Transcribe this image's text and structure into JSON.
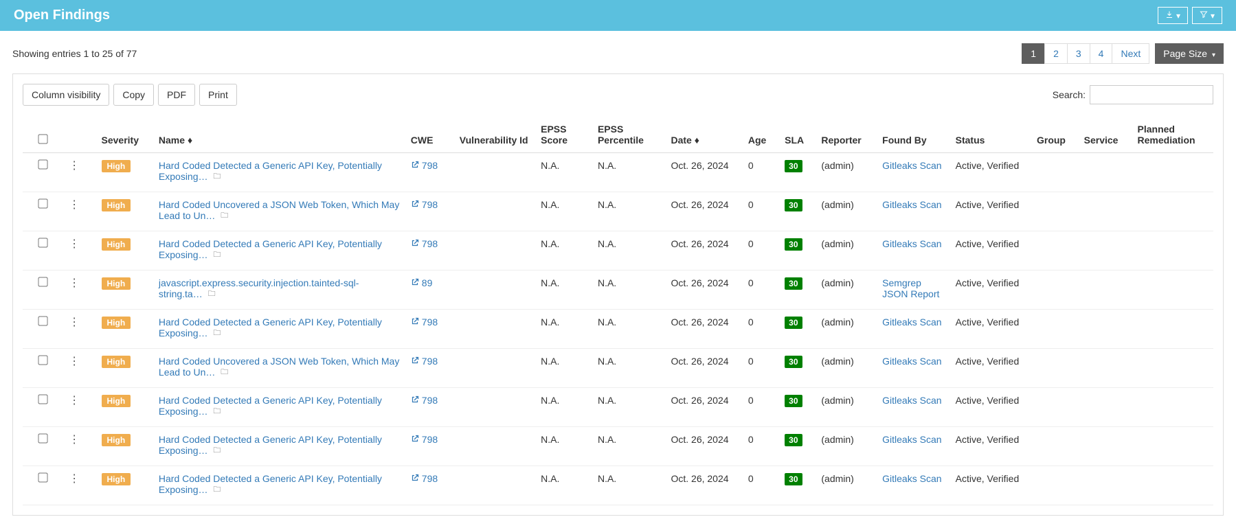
{
  "header": {
    "title": "Open Findings"
  },
  "showing": "Showing entries 1 to 25 of 77",
  "pagination": {
    "pages": [
      "1",
      "2",
      "3",
      "4"
    ],
    "active": 0,
    "next": "Next",
    "page_size": "Page Size "
  },
  "toolbar": {
    "column_visibility": "Column visibility",
    "copy": "Copy",
    "pdf": "PDF",
    "print": "Print"
  },
  "search": {
    "label": "Search:",
    "value": ""
  },
  "columns": [
    "",
    "",
    "Severity",
    "Name",
    "CWE",
    "Vulnerability Id",
    "EPSS Score",
    "EPSS Percentile",
    "Date",
    "Age",
    "SLA",
    "Reporter",
    "Found By",
    "Status",
    "Group",
    "Service",
    "Planned Remediation"
  ],
  "rows": [
    {
      "severity": "High",
      "name": "Hard Coded Detected a Generic API Key, Potentially Exposing…",
      "cwe": "798",
      "epss_score": "N.A.",
      "epss_pct": "N.A.",
      "date": "Oct. 26, 2024",
      "age": "0",
      "sla": "30",
      "reporter": "(admin)",
      "found_by": "Gitleaks Scan",
      "status": "Active, Verified"
    },
    {
      "severity": "High",
      "name": "Hard Coded Uncovered a JSON Web Token, Which May Lead to Un…",
      "cwe": "798",
      "epss_score": "N.A.",
      "epss_pct": "N.A.",
      "date": "Oct. 26, 2024",
      "age": "0",
      "sla": "30",
      "reporter": "(admin)",
      "found_by": "Gitleaks Scan",
      "status": "Active, Verified"
    },
    {
      "severity": "High",
      "name": "Hard Coded Detected a Generic API Key, Potentially Exposing…",
      "cwe": "798",
      "epss_score": "N.A.",
      "epss_pct": "N.A.",
      "date": "Oct. 26, 2024",
      "age": "0",
      "sla": "30",
      "reporter": "(admin)",
      "found_by": "Gitleaks Scan",
      "status": "Active, Verified"
    },
    {
      "severity": "High",
      "name": "javascript.express.security.injection.tainted-sql-string.ta…",
      "cwe": "89",
      "epss_score": "N.A.",
      "epss_pct": "N.A.",
      "date": "Oct. 26, 2024",
      "age": "0",
      "sla": "30",
      "reporter": "(admin)",
      "found_by": "Semgrep JSON Report",
      "status": "Active, Verified"
    },
    {
      "severity": "High",
      "name": "Hard Coded Detected a Generic API Key, Potentially Exposing…",
      "cwe": "798",
      "epss_score": "N.A.",
      "epss_pct": "N.A.",
      "date": "Oct. 26, 2024",
      "age": "0",
      "sla": "30",
      "reporter": "(admin)",
      "found_by": "Gitleaks Scan",
      "status": "Active, Verified"
    },
    {
      "severity": "High",
      "name": "Hard Coded Uncovered a JSON Web Token, Which May Lead to Un…",
      "cwe": "798",
      "epss_score": "N.A.",
      "epss_pct": "N.A.",
      "date": "Oct. 26, 2024",
      "age": "0",
      "sla": "30",
      "reporter": "(admin)",
      "found_by": "Gitleaks Scan",
      "status": "Active, Verified"
    },
    {
      "severity": "High",
      "name": "Hard Coded Detected a Generic API Key, Potentially Exposing…",
      "cwe": "798",
      "epss_score": "N.A.",
      "epss_pct": "N.A.",
      "date": "Oct. 26, 2024",
      "age": "0",
      "sla": "30",
      "reporter": "(admin)",
      "found_by": "Gitleaks Scan",
      "status": "Active, Verified"
    },
    {
      "severity": "High",
      "name": "Hard Coded Detected a Generic API Key, Potentially Exposing…",
      "cwe": "798",
      "epss_score": "N.A.",
      "epss_pct": "N.A.",
      "date": "Oct. 26, 2024",
      "age": "0",
      "sla": "30",
      "reporter": "(admin)",
      "found_by": "Gitleaks Scan",
      "status": "Active, Verified"
    },
    {
      "severity": "High",
      "name": "Hard Coded Detected a Generic API Key, Potentially Exposing…",
      "cwe": "798",
      "epss_score": "N.A.",
      "epss_pct": "N.A.",
      "date": "Oct. 26, 2024",
      "age": "0",
      "sla": "30",
      "reporter": "(admin)",
      "found_by": "Gitleaks Scan",
      "status": "Active, Verified"
    }
  ]
}
